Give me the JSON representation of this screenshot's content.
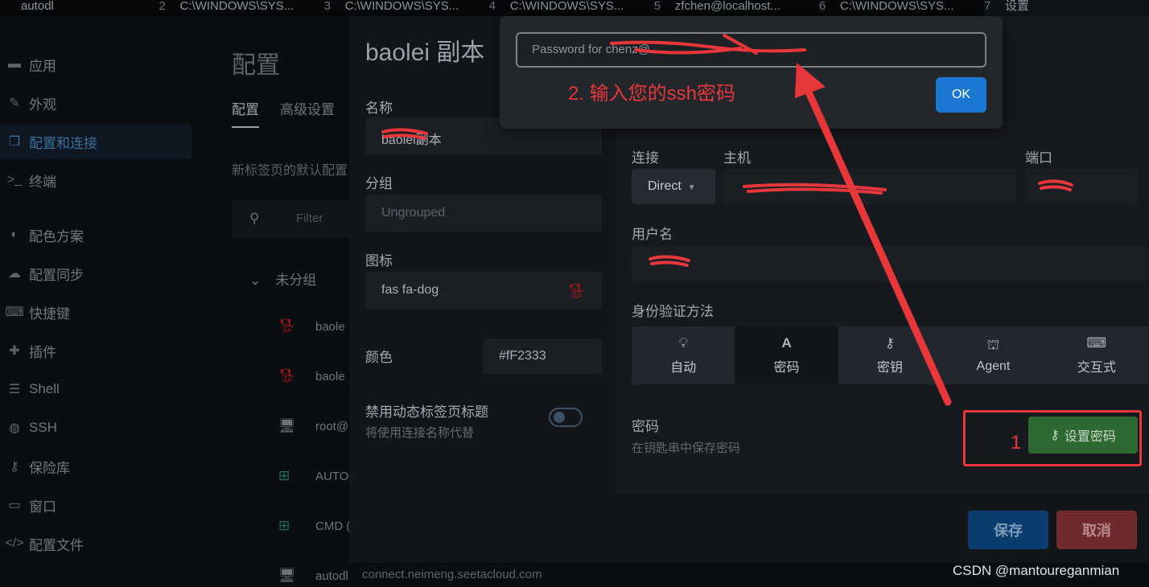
{
  "tabs": [
    {
      "num": "",
      "title": "autodl"
    },
    {
      "num": "2",
      "title": "C:\\WINDOWS\\SYS..."
    },
    {
      "num": "3",
      "title": "C:\\WINDOWS\\SYS..."
    },
    {
      "num": "4",
      "title": "C:\\WINDOWS\\SYS..."
    },
    {
      "num": "5",
      "title": "zfchen@localhost..."
    },
    {
      "num": "6",
      "title": "C:\\WINDOWS\\SYS..."
    },
    {
      "num": "7",
      "title": "设置"
    }
  ],
  "sidebar": {
    "items": [
      {
        "label": "应用",
        "icon": "app-window-icon"
      },
      {
        "label": "外观",
        "icon": "brush-icon"
      },
      {
        "label": "配置和连接",
        "icon": "profiles-icon"
      },
      {
        "label": "终端",
        "icon": "terminal-icon"
      },
      {
        "label": "配色方案",
        "icon": "palette-icon"
      },
      {
        "label": "配置同步",
        "icon": "cloud-icon"
      },
      {
        "label": "快捷键",
        "icon": "keyboard-icon"
      },
      {
        "label": "插件",
        "icon": "puzzle-icon"
      },
      {
        "label": "Shell",
        "icon": "list-icon"
      },
      {
        "label": "SSH",
        "icon": "globe-icon"
      },
      {
        "label": "保险库",
        "icon": "key-icon"
      },
      {
        "label": "窗口",
        "icon": "window-icon"
      },
      {
        "label": "配置文件",
        "icon": "code-icon"
      }
    ],
    "active_index": 2
  },
  "settings": {
    "title": "配置",
    "tabs": [
      "配置",
      "高级设置"
    ],
    "description": "新标签页的默认配置",
    "filter_placeholder": "Filter",
    "group": "未分组",
    "connections": [
      {
        "label": "baole",
        "icon": "dog-icon"
      },
      {
        "label": "baole",
        "icon": "dog-icon"
      },
      {
        "label": "root@",
        "icon": "monitor-icon"
      },
      {
        "label": "AUTO",
        "icon": "windows-icon"
      },
      {
        "label": "CMD (",
        "icon": "windows-icon"
      },
      {
        "label": "autodl",
        "icon": "monitor-icon"
      }
    ],
    "last_connection_url": "connect.neimeng.seetacloud.com"
  },
  "modal": {
    "title": "baolei 副本",
    "name_label": "名称",
    "name_value": "baolei副本",
    "group_label": "分组",
    "group_placeholder": "Ungrouped",
    "icon_label": "图标",
    "icon_value": "fas fa-dog",
    "color_label": "颜色",
    "color_value": "#fF2333",
    "disable_dynamic_title_label": "禁用动态标签页标题",
    "disable_dynamic_title_sub": "将使用连接名称代替",
    "connection_label": "连接",
    "connection_value": "Direct",
    "host_label": "主机",
    "host_value": "",
    "port_label": "端口",
    "port_value": "",
    "username_label": "用户名",
    "username_value": "",
    "auth_label": "身份验证方法",
    "auth_options": [
      {
        "label": "自动",
        "icon": "lightbulb-icon"
      },
      {
        "label": "密码",
        "icon": "font-icon"
      },
      {
        "label": "密钥",
        "icon": "key-icon"
      },
      {
        "label": "Agent",
        "icon": "user-secret-icon"
      },
      {
        "label": "交互式",
        "icon": "keyboard-icon"
      }
    ],
    "auth_selected": 1,
    "password_label": "密码",
    "password_sub": "在钥匙串中保存密码",
    "set_password_button": "设置密码",
    "save_button": "保存",
    "cancel_button": "取消"
  },
  "prompt": {
    "input_placeholder": "Password for chenz@...",
    "ok_button": "OK"
  },
  "annotations": {
    "step2": "2. 输入您的ssh密码",
    "step1": "1",
    "color": "#e8373b"
  },
  "watermark": "CSDN @mantoureganmian"
}
